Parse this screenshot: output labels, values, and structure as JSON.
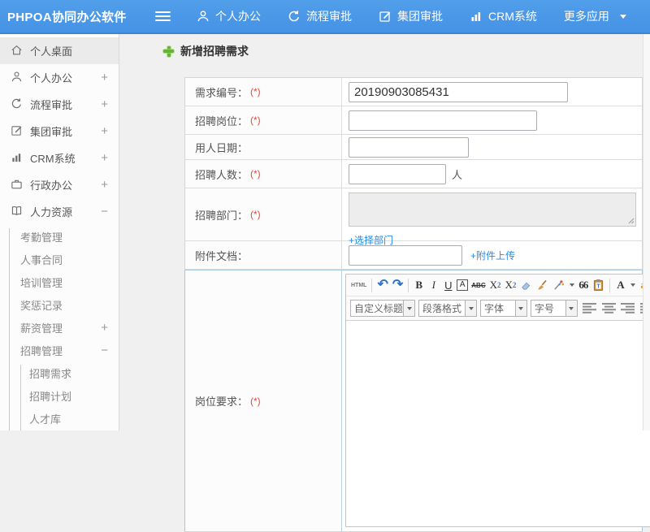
{
  "colors": {
    "header_blue": "#4997e9",
    "accent_green": "#62b531",
    "link_blue": "#2b8ce8",
    "required_red": "#e8463c"
  },
  "header": {
    "app_title": "PHPOA协同办公软件",
    "nav": [
      {
        "label": "个人办公",
        "icon": "user-icon"
      },
      {
        "label": "流程审批",
        "icon": "process-icon"
      },
      {
        "label": "集团审批",
        "icon": "edit-icon"
      },
      {
        "label": "CRM系统",
        "icon": "bar-chart-icon"
      },
      {
        "label": "更多应用",
        "icon": "caret-down-icon"
      }
    ]
  },
  "sidebar": {
    "items": [
      {
        "label": "个人桌面",
        "icon": "home-icon",
        "expand": "",
        "active": true
      },
      {
        "label": "个人办公",
        "icon": "user-icon",
        "expand": "+"
      },
      {
        "label": "流程审批",
        "icon": "process-icon",
        "expand": "+"
      },
      {
        "label": "集团审批",
        "icon": "edit-icon",
        "expand": "+"
      },
      {
        "label": "CRM系统",
        "icon": "bar-chart-icon",
        "expand": "+"
      },
      {
        "label": "行政办公",
        "icon": "briefcase-icon",
        "expand": "+"
      },
      {
        "label": "人力资源",
        "icon": "book-icon",
        "expand": "−"
      }
    ],
    "hr_children": [
      {
        "label": "考勤管理",
        "expand": ""
      },
      {
        "label": "人事合同",
        "expand": ""
      },
      {
        "label": "培训管理",
        "expand": ""
      },
      {
        "label": "奖惩记录",
        "expand": ""
      },
      {
        "label": "薪资管理",
        "expand": "+"
      },
      {
        "label": "招聘管理",
        "expand": "−"
      }
    ],
    "recruit_children": [
      {
        "label": "招聘需求"
      },
      {
        "label": "招聘计划"
      },
      {
        "label": "人才库"
      }
    ]
  },
  "main": {
    "page_title": "新增招聘需求",
    "form": {
      "required_mark": "(*)",
      "fields": {
        "demand_no": {
          "label": "需求编号：",
          "value": "20190903085431",
          "required": true
        },
        "position": {
          "label": "招聘岗位：",
          "value": "",
          "required": true
        },
        "date": {
          "label": "用人日期：",
          "value": ""
        },
        "count": {
          "label": "招聘人数：",
          "value": "",
          "required": true,
          "suffix": "人"
        },
        "dept": {
          "label": "招聘部门：",
          "required": true,
          "link": "+选择部门"
        },
        "attachment": {
          "label": "附件文档：",
          "value": "",
          "link": "+附件上传"
        },
        "requirement": {
          "label": "岗位要求：",
          "required": true
        }
      }
    },
    "editor": {
      "toolbar1": {
        "html": "HTML",
        "bold": "B",
        "italic": "I",
        "underline": "U",
        "autotype": "A",
        "strike": "ABC",
        "sup_base": "X",
        "sup_mark": "2",
        "sub_base": "X",
        "sub_mark": "2",
        "quote": "66",
        "fontcolor": "A",
        "edge": "a"
      },
      "toolbar2": {
        "dropdowns": [
          "自定义标题",
          "段落格式",
          "字体",
          "字号"
        ]
      }
    }
  }
}
